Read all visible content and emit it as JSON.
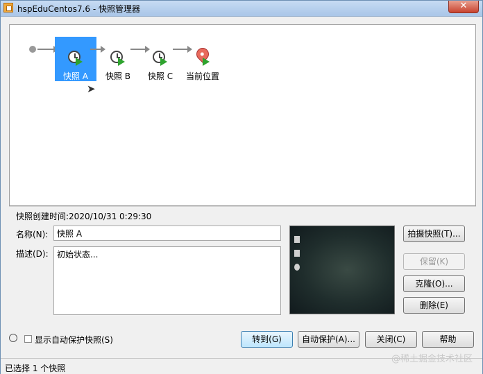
{
  "window": {
    "title": "hspEduCentos7.6 - 快照管理器",
    "close_label": "✕"
  },
  "tree": {
    "nodes": [
      {
        "label": "快照 A",
        "selected": true,
        "icon": "clock-icon"
      },
      {
        "label": "快照 B",
        "selected": false,
        "icon": "clock-icon"
      },
      {
        "label": "快照 C",
        "selected": false,
        "icon": "clock-icon"
      },
      {
        "label": "当前位置",
        "selected": false,
        "icon": "location-pin-icon"
      }
    ]
  },
  "details": {
    "created": "快照创建时间:2020/10/31 0:29:30",
    "name_label": "名称(N):",
    "name_value": "快照 A",
    "desc_label": "描述(D):",
    "desc_value": "初始状态..."
  },
  "side_buttons": {
    "take": "拍摄快照(T)...",
    "keep": "保留(K)",
    "clone": "克隆(O)...",
    "delete": "删除(E)"
  },
  "bottom": {
    "autoprotect_checkbox": "显示自动保护快照(S)",
    "goto": "转到(G)",
    "autoprotect": "自动保护(A)...",
    "close": "关闭(C)",
    "help": "帮助"
  },
  "status": {
    "text": "已选择 1 个快照"
  },
  "watermark": "@稀土掘金技术社区"
}
